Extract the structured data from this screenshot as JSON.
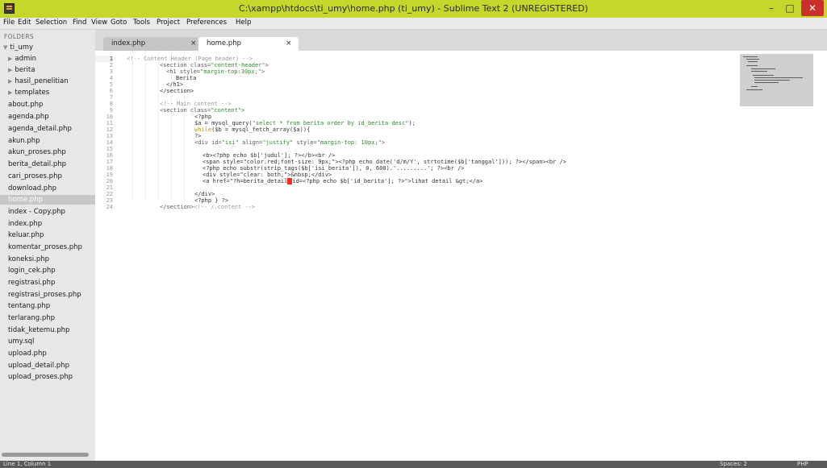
{
  "window": {
    "title": "C:\\xampp\\htdocs\\ti_umy\\home.php (ti_umy) - Sublime Text 2 (UNREGISTERED)",
    "minimize_label": "–",
    "maximize_label": "□",
    "close_label": "✕"
  },
  "menu": [
    "File",
    "Edit",
    "Selection",
    "Find",
    "View",
    "Goto",
    "Tools",
    "Project",
    "Preferences",
    "Help"
  ],
  "sidebar": {
    "header": "FOLDERS",
    "root": "ti_umy",
    "folders": [
      "admin",
      "berita",
      "hasil_penelitian",
      "templates"
    ],
    "files": [
      "about.php",
      "agenda.php",
      "agenda_detail.php",
      "akun.php",
      "akun_proses.php",
      "berita_detail.php",
      "cari_proses.php",
      "download.php",
      "home.php",
      "index - Copy.php",
      "index.php",
      "keluar.php",
      "komentar_proses.php",
      "koneksi.php",
      "login_cek.php",
      "registrasi.php",
      "registrasi_proses.php",
      "tentang.php",
      "terlarang.php",
      "tidak_ketemu.php",
      "umy.sql",
      "upload.php",
      "upload_detail.php",
      "upload_proses.php"
    ],
    "active_file": "home.php"
  },
  "tabs": [
    {
      "label": "index.php",
      "close": "×"
    },
    {
      "label": "home.php",
      "close": "×"
    }
  ],
  "code": {
    "line_numbers": [
      "1",
      "2",
      "3",
      "4",
      "5",
      "6",
      "7",
      "8",
      "9",
      "10",
      "11",
      "12",
      "13",
      "14",
      "15",
      "16",
      "17",
      "18",
      "19",
      "20",
      "21",
      "22",
      "23",
      "24"
    ],
    "l1": "<!-- Content Header (Page header) -->",
    "l2_tag": "<section class=",
    "l2_val": "\"content-header\"",
    "l2_end": ">",
    "l3_tag": "<h1 style=",
    "l3_val": "\"margin-top:30px;\"",
    "l3_end": ">",
    "l4": "Berita",
    "l5": "</h1>",
    "l6": "</section>",
    "l8": "<!-- Main content -->",
    "l9_tag": "<section class=",
    "l9_val": "\"content\"",
    "l9_end": ">",
    "l10": "<?php",
    "l11_a": "$a = mysql_query(",
    "l11_b": "\"select * from berita order by id_berita desc\"",
    "l11_c": ");",
    "l12_a": "while",
    "l12_b": "($b = mysql_fetch_array($a)){",
    "l13": "?>",
    "l14_tag": "<div id=",
    "l14_v1": "\"isi\"",
    "l14_m": " align=",
    "l14_v2": "\"justify\"",
    "l14_m2": " style=",
    "l14_v3": "\"margin-top: 10px;\"",
    "l14_end": ">",
    "l16": "<b><?php echo $b['judul']; ?></b><br />",
    "l17": "<span style=\"color:red;font-size: 9px;\"><?php echo date('d/m/Y', strtotime($b['tanggal'])); ?></span><br />",
    "l18": "<?php echo substr(strip_tags($b['isi_berita']), 0, 600).'.........'; ?><br />",
    "l19": "<div style=\"clear: both;\">&nbsp;</div>",
    "l20_a": "<a href=\"?h=berita_detail",
    "l20_b": "id=<?php echo $b['id_berita']; ?>\">lihat detail &gt;</a>",
    "l22": "</div>",
    "l23": "<?php } ?>",
    "l24_a": "</section>",
    "l24_b": "<!-- /.content -->"
  },
  "status": {
    "position": "Line 1, Column 1",
    "spaces": "Spaces: 2",
    "syntax": "PHP"
  }
}
